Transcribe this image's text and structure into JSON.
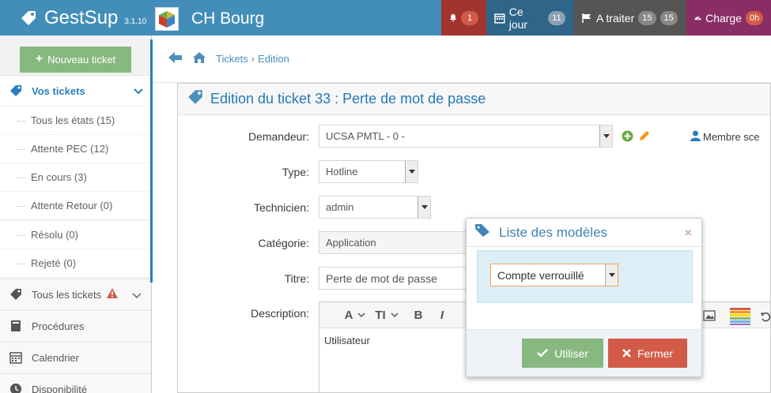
{
  "app": {
    "name": "GestSup",
    "version": "3.1.10",
    "company": "CH Bourg"
  },
  "topnav": {
    "alerts_count": "1",
    "today_label": "Ce jour",
    "today_count": "11",
    "todo_label": "A traiter",
    "todo_count_1": "15",
    "todo_count_2": "15",
    "load_label": "Charge",
    "load_value": "0h"
  },
  "sidebar": {
    "new_ticket": "Nouveau ticket",
    "your_tickets": "Vos tickets",
    "sub_items": [
      "Tous les états (15)",
      "Attente PEC (12)",
      "En cours (3)",
      "Attente Retour (0)",
      "Résolu (0)",
      "Rejeté (0)"
    ],
    "all_tickets": "Tous les tickets",
    "procedures": "Procédures",
    "calendar": "Calendrier",
    "availability": "Disponibilité"
  },
  "breadcrumb": {
    "tickets": "Tickets",
    "separator": "›",
    "current": "Edition"
  },
  "form": {
    "title": "Edition du ticket 33 : Perte de mot de passe",
    "requester_label": "Demandeur:",
    "requester_value": "UCSA PMTL - 0 -",
    "member_link": "Membre sce",
    "type_label": "Type:",
    "type_value": "Hotline",
    "tech_label": "Technicien:",
    "tech_value": "admin",
    "category_label": "Catégorie:",
    "category_value": "Application",
    "title_label": "Titre:",
    "title_value": "Perte de mot de passe",
    "description_label": "Description:",
    "description_value": "Utilisateur"
  },
  "toolbar": {
    "font": "A",
    "size": "TI",
    "bold": "B",
    "italic": "I"
  },
  "modal": {
    "title": "Liste des modèles",
    "close": "×",
    "selected": "Compte verrouillé",
    "use_label": "Utiliser",
    "close_label": "Fermer"
  },
  "colors": {
    "navbar": "#438eb9",
    "accent": "#2b7dbc",
    "green": "#87b87f",
    "red": "#d15b47",
    "alerts_bg": "#a0352f",
    "today_bg": "#2e6589",
    "todo_bg": "#555555",
    "load_bg": "#892e65"
  }
}
